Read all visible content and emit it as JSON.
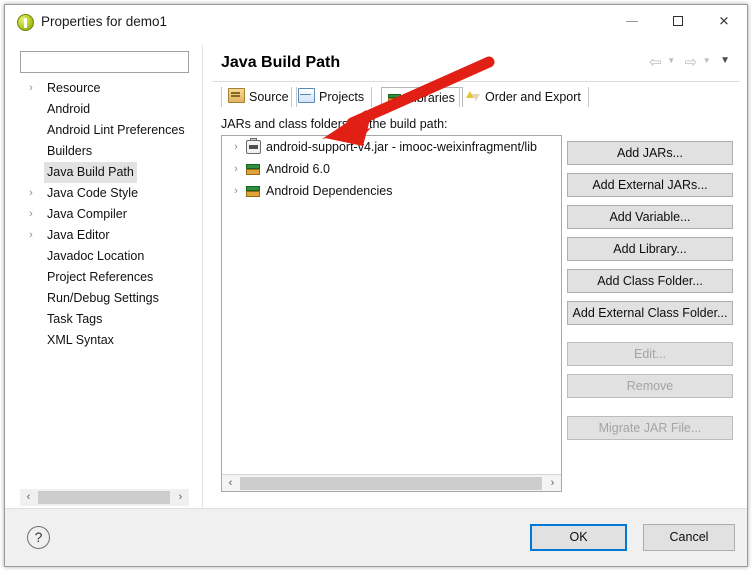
{
  "window": {
    "title": "Properties for demo1",
    "icon": "eclipse-properties-icon",
    "controls": {
      "minimize": "minimize-icon",
      "maximize": "maximize-icon",
      "close": "close-icon"
    }
  },
  "sidebar": {
    "filter": {
      "value": "",
      "placeholder": ""
    },
    "items": [
      {
        "label": "Resource",
        "expandable": true,
        "selected": false
      },
      {
        "label": "Android",
        "expandable": false,
        "selected": false
      },
      {
        "label": "Android Lint Preferences",
        "expandable": false,
        "selected": false
      },
      {
        "label": "Builders",
        "expandable": false,
        "selected": false
      },
      {
        "label": "Java Build Path",
        "expandable": false,
        "selected": true
      },
      {
        "label": "Java Code Style",
        "expandable": true,
        "selected": false
      },
      {
        "label": "Java Compiler",
        "expandable": true,
        "selected": false
      },
      {
        "label": "Java Editor",
        "expandable": true,
        "selected": false
      },
      {
        "label": "Javadoc Location",
        "expandable": false,
        "selected": false
      },
      {
        "label": "Project References",
        "expandable": false,
        "selected": false
      },
      {
        "label": "Run/Debug Settings",
        "expandable": false,
        "selected": false
      },
      {
        "label": "Task Tags",
        "expandable": false,
        "selected": false
      },
      {
        "label": "XML Syntax",
        "expandable": false,
        "selected": false
      }
    ],
    "scroll": {
      "left_arrow": "‹",
      "right_arrow": "›"
    }
  },
  "page": {
    "title": "Java Build Path",
    "nav": {
      "back": "back-arrow-icon",
      "back_menu": "▼",
      "forward": "forward-arrow-icon",
      "forward_menu": "▼",
      "view_menu": "▼"
    },
    "tabs": [
      {
        "label": "Source",
        "icon": "source-folder-icon",
        "active": false
      },
      {
        "label": "Projects",
        "icon": "projects-folder-icon",
        "active": false
      },
      {
        "label": "Libraries",
        "icon": "libraries-books-icon",
        "active": true
      },
      {
        "label": "Order and Export",
        "icon": "order-export-arrows-icon",
        "active": false
      }
    ],
    "list_label": "JARs and class folders on the build path:",
    "entries": [
      {
        "label": "android-support-v4.jar - imooc-weixinfragment/lib",
        "icon": "jar-icon",
        "expandable": true
      },
      {
        "label": "Android 6.0",
        "icon": "library-icon",
        "expandable": true
      },
      {
        "label": "Android Dependencies",
        "icon": "library-icon",
        "expandable": true
      }
    ],
    "list_scroll": {
      "left_arrow": "‹",
      "right_arrow": "›"
    },
    "buttons": [
      {
        "label": "Add JARs...",
        "enabled": true
      },
      {
        "label": "Add External JARs...",
        "enabled": true
      },
      {
        "label": "Add Variable...",
        "enabled": true
      },
      {
        "label": "Add Library...",
        "enabled": true
      },
      {
        "label": "Add Class Folder...",
        "enabled": true
      },
      {
        "label": "Add External Class Folder...",
        "enabled": true
      },
      {
        "label": "Edit...",
        "enabled": false
      },
      {
        "label": "Remove",
        "enabled": false
      },
      {
        "label": "Migrate JAR File...",
        "enabled": false
      }
    ]
  },
  "footer": {
    "help": "?",
    "ok": "OK",
    "cancel": "Cancel"
  },
  "annotation": {
    "type": "red-arrow",
    "color": "#e21f15",
    "points_to": "Libraries tab / android-support-v4.jar entry"
  }
}
